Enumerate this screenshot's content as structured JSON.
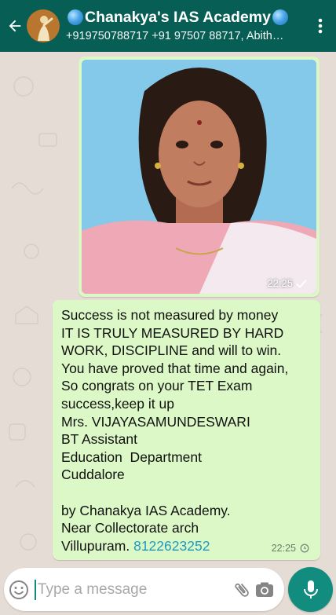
{
  "header": {
    "title": "Chanakya's IAS Academy",
    "subtitle": "+919750788717 +91 97507 88717, Abith…",
    "back_icon": "arrow-left-icon",
    "menu_icon": "more-vertical-icon"
  },
  "messages": {
    "image_message": {
      "time": "22:25",
      "status_icon": "check-icon"
    },
    "text_message": {
      "lines": [
        "Success is not measured by money",
        "IT IS TRULY MEASURED BY HARD",
        "WORK, DISCIPLINE and will to win.",
        "You have proved that time and again,",
        "So congrats on your TET Exam",
        "success,keep it up",
        "Mrs. VIJAYASAMUNDESWARI",
        "BT Assistant",
        "Education  Department",
        "Cuddalore",
        "",
        "by Chanakya IAS Academy.",
        "Near Collectorate arch",
        "Villupuram. "
      ],
      "phone": "8122623252",
      "time": "22:25",
      "status_icon": "clock-icon"
    }
  },
  "composer": {
    "placeholder": "Type a message",
    "value": ""
  },
  "colors": {
    "header_bg": "#075e54",
    "bubble_bg": "#dcf8c6",
    "accent": "#128c7e",
    "link": "#1c9bc2"
  }
}
